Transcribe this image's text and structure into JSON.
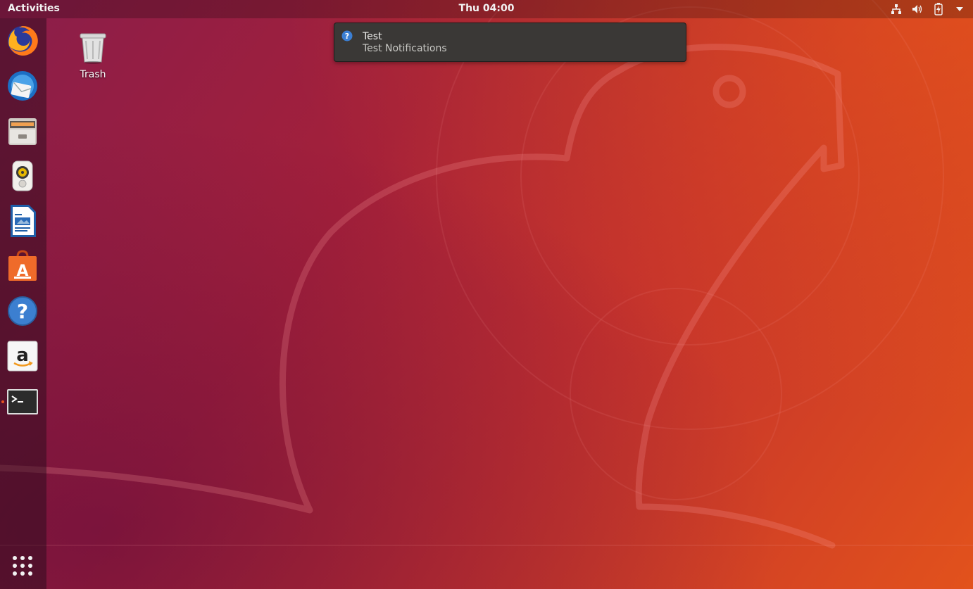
{
  "topbar": {
    "activities_label": "Activities",
    "clock": "Thu 04:00",
    "tray_icons": [
      "network-icon",
      "volume-icon",
      "battery-icon",
      "system-menu-arrow-icon"
    ]
  },
  "dock": {
    "items": [
      {
        "name": "firefox",
        "icon": "firefox-icon"
      },
      {
        "name": "thunderbird",
        "icon": "thunderbird-icon"
      },
      {
        "name": "files",
        "icon": "files-icon"
      },
      {
        "name": "rhythmbox",
        "icon": "rhythmbox-icon"
      },
      {
        "name": "libreoffice-writer",
        "icon": "writer-icon"
      },
      {
        "name": "ubuntu-software",
        "icon": "software-icon"
      },
      {
        "name": "help",
        "icon": "help-icon"
      },
      {
        "name": "amazon",
        "icon": "amazon-icon"
      },
      {
        "name": "terminal",
        "icon": "terminal-icon",
        "running": true
      }
    ],
    "show_apps_icon": "app-grid-icon"
  },
  "desktop": {
    "icons": [
      {
        "label": "Trash",
        "icon": "trash-icon"
      }
    ]
  },
  "notification": {
    "title": "Test",
    "body": "Test Notifications",
    "icon": "question-icon"
  },
  "colors": {
    "accent": "#e95420",
    "topbar_text": "#f2f2f2",
    "notification_bg": "#3a3836"
  }
}
